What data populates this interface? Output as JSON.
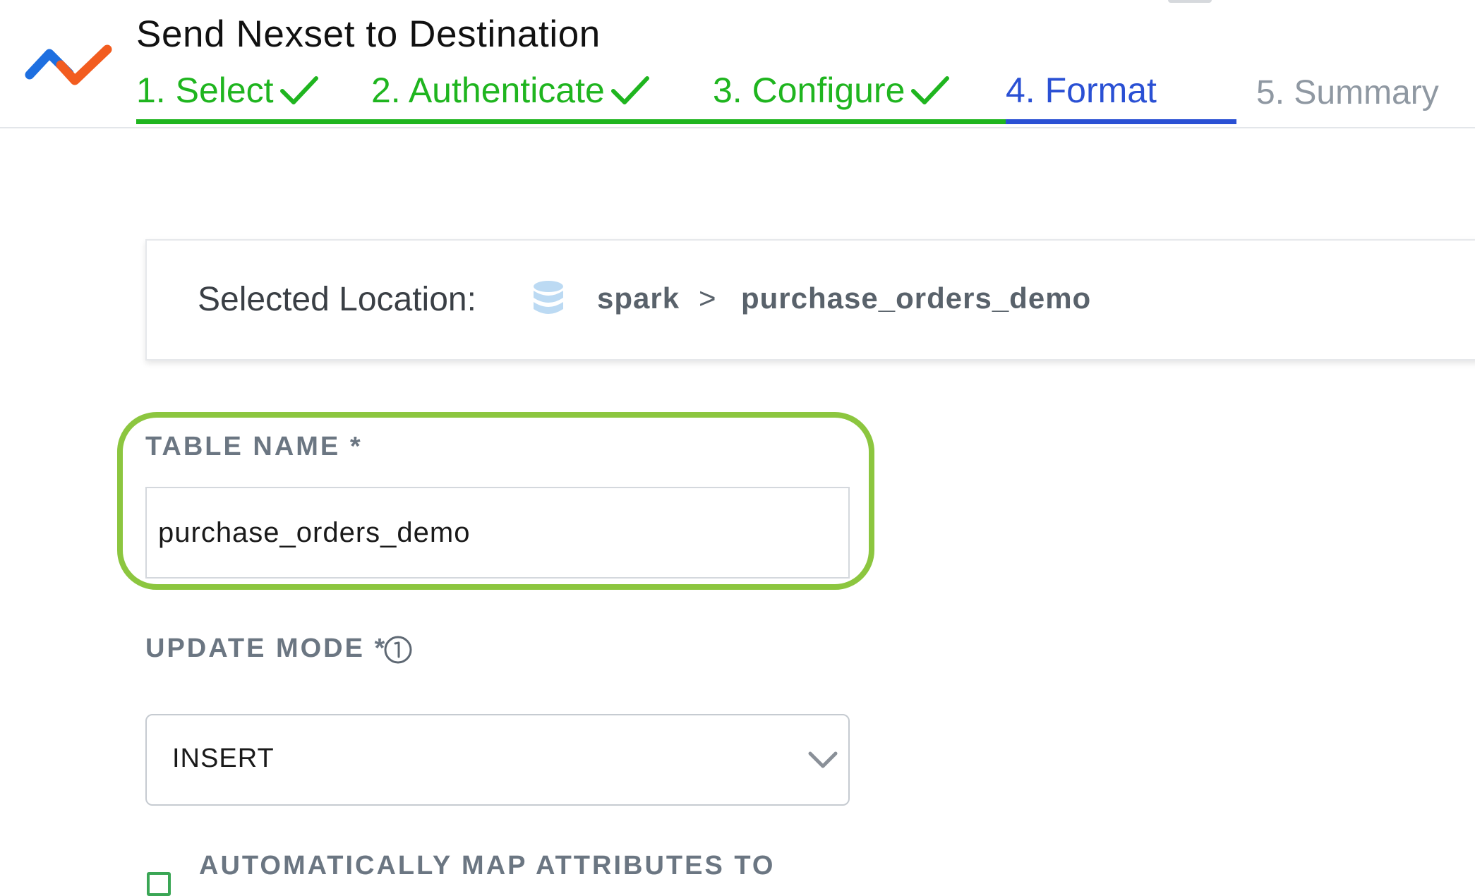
{
  "header": {
    "title": "Send Nexset to Destination",
    "steps": [
      {
        "label": "1. Select",
        "state": "done"
      },
      {
        "label": "2. Authenticate",
        "state": "done"
      },
      {
        "label": "3. Configure",
        "state": "done"
      },
      {
        "label": "4. Format",
        "state": "active"
      },
      {
        "label": "5. Summary",
        "state": "todo"
      }
    ],
    "colors": {
      "done": "#1fb51f",
      "active": "#2a50d4",
      "todo": "#8f98a2"
    }
  },
  "location": {
    "label": "Selected Location:",
    "icon": "database-icon",
    "path": [
      "spark",
      "purchase_orders_demo"
    ],
    "separator": ">"
  },
  "form": {
    "table_name": {
      "label": "TABLE NAME *",
      "value": "purchase_orders_demo"
    },
    "update_mode": {
      "label": "UPDATE MODE *",
      "icon": "info-icon",
      "value": "INSERT"
    },
    "auto_map": {
      "label": "AUTOMATICALLY MAP ATTRIBUTES TO",
      "checked": false
    }
  },
  "highlight_color": "#8cc63f"
}
